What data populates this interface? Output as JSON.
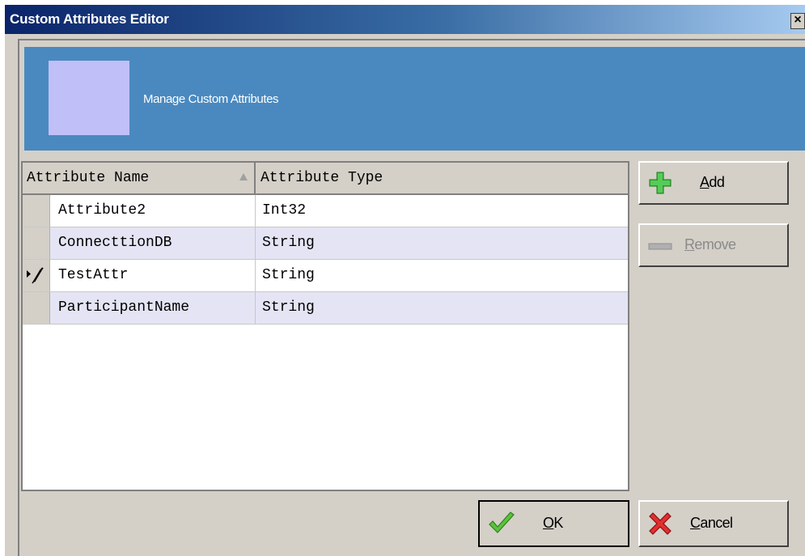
{
  "window": {
    "title": "Custom Attributes Editor",
    "close_glyph": "×"
  },
  "banner": {
    "text": "Manage Custom Attributes",
    "image_color": "#c0bff7",
    "bg_color": "#4a89bf"
  },
  "grid": {
    "columns": [
      "Attribute Name",
      "Attribute Type"
    ],
    "sort_column": "Attribute Name",
    "rows": [
      {
        "name": "Attribute2",
        "type": "Int32",
        "indicator": ""
      },
      {
        "name": "ConnecttionDB",
        "type": "String",
        "indicator": ""
      },
      {
        "name": "TestAttr",
        "type": "String",
        "indicator": "edit-pencil-icon"
      },
      {
        "name": "ParticipantName",
        "type": "String",
        "indicator": ""
      }
    ]
  },
  "buttons": {
    "add": {
      "label_underlined": "A",
      "label_rest": "dd",
      "icon": "green-plus-icon"
    },
    "remove": {
      "label_underlined": "R",
      "label_rest": "emove",
      "icon": "minus-icon",
      "enabled": false
    },
    "ok": {
      "label_underlined": "O",
      "label_rest": "K",
      "icon": "green-check-icon"
    },
    "cancel": {
      "label_underlined": "C",
      "label_rest": "ancel",
      "icon": "red-x-icon"
    }
  }
}
